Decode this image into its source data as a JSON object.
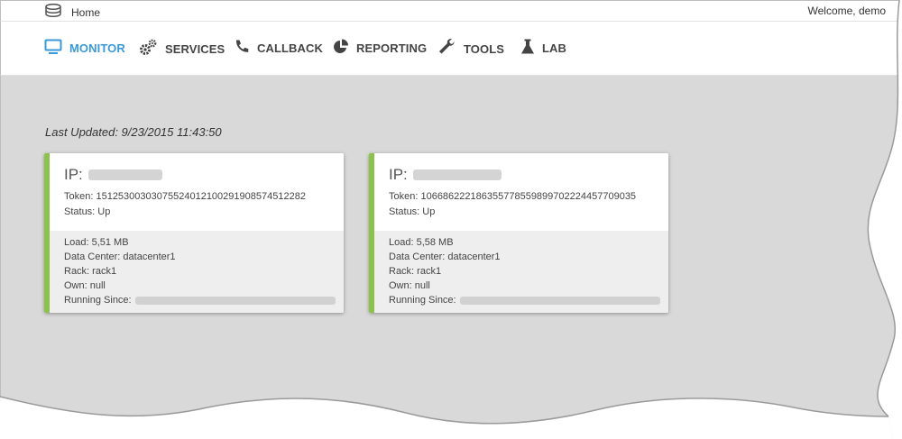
{
  "topbar": {
    "home_label": "Home",
    "welcome": "Welcome, demo"
  },
  "nav": [
    {
      "label": "MONITOR",
      "icon": "monitor-icon",
      "active": true
    },
    {
      "label": "SERVICES",
      "icon": "gears-icon"
    },
    {
      "label": "CALLBACK",
      "icon": "phone-icon"
    },
    {
      "label": "REPORTING",
      "icon": "pie-chart-icon"
    },
    {
      "label": "TOOLS",
      "icon": "wrench-icon"
    },
    {
      "label": "LAB",
      "icon": "flask-icon"
    }
  ],
  "last_updated": "Last Updated: 9/23/2015 11:43:50",
  "nodes": [
    {
      "ip_label": "IP:",
      "token": "Token: 151253003030755240121002919085745122​82",
      "status": "Status: Up",
      "load": "Load: 5,51 MB",
      "data_center": "Data Center: datacenter1",
      "rack": "Rack: rack1",
      "own": "Own: null",
      "running_since_label": "Running Since:"
    },
    {
      "ip_label": "IP:",
      "token": "Token: 106686222186355778559899702224457709035",
      "status": "Status: Up",
      "load": "Load: 5,58 MB",
      "data_center": "Data Center: datacenter1",
      "rack": "Rack: rack1",
      "own": "Own: null",
      "running_since_label": "Running Since:"
    }
  ],
  "colors": {
    "accent": "#3a9ad9",
    "status_up": "#8bc34a",
    "background": "#d9d9d9"
  }
}
